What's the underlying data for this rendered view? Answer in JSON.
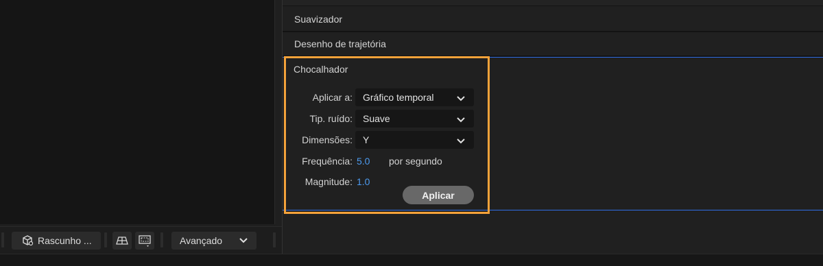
{
  "viewer_toolbar": {
    "draft_label": "Rascunho ...",
    "mode_label": "Avançado"
  },
  "panel": {
    "sections": {
      "smoother": "Suavizador",
      "motion_sketch": "Desenho de trajetória",
      "wiggler": "Chocalhador"
    },
    "wiggler": {
      "apply_to_label": "Aplicar a:",
      "apply_to_value": "Gráfico temporal",
      "noise_type_label": "Tip. ruído:",
      "noise_type_value": "Suave",
      "dimension_label": "Dimensões:",
      "dimension_value": "Y",
      "frequency_label": "Frequência:",
      "frequency_value": "5.0",
      "frequency_unit": "por segundo",
      "magnitude_label": "Magnitude:",
      "magnitude_value": "1.0",
      "apply_button": "Aplicar"
    }
  },
  "colors": {
    "highlight": "#f4a23a",
    "value_blue": "#4d9bf0",
    "selection_line": "#2f6ee6"
  },
  "icons": [
    "cube-icon",
    "grid-icon",
    "region-icon",
    "chevron-down-icon"
  ]
}
